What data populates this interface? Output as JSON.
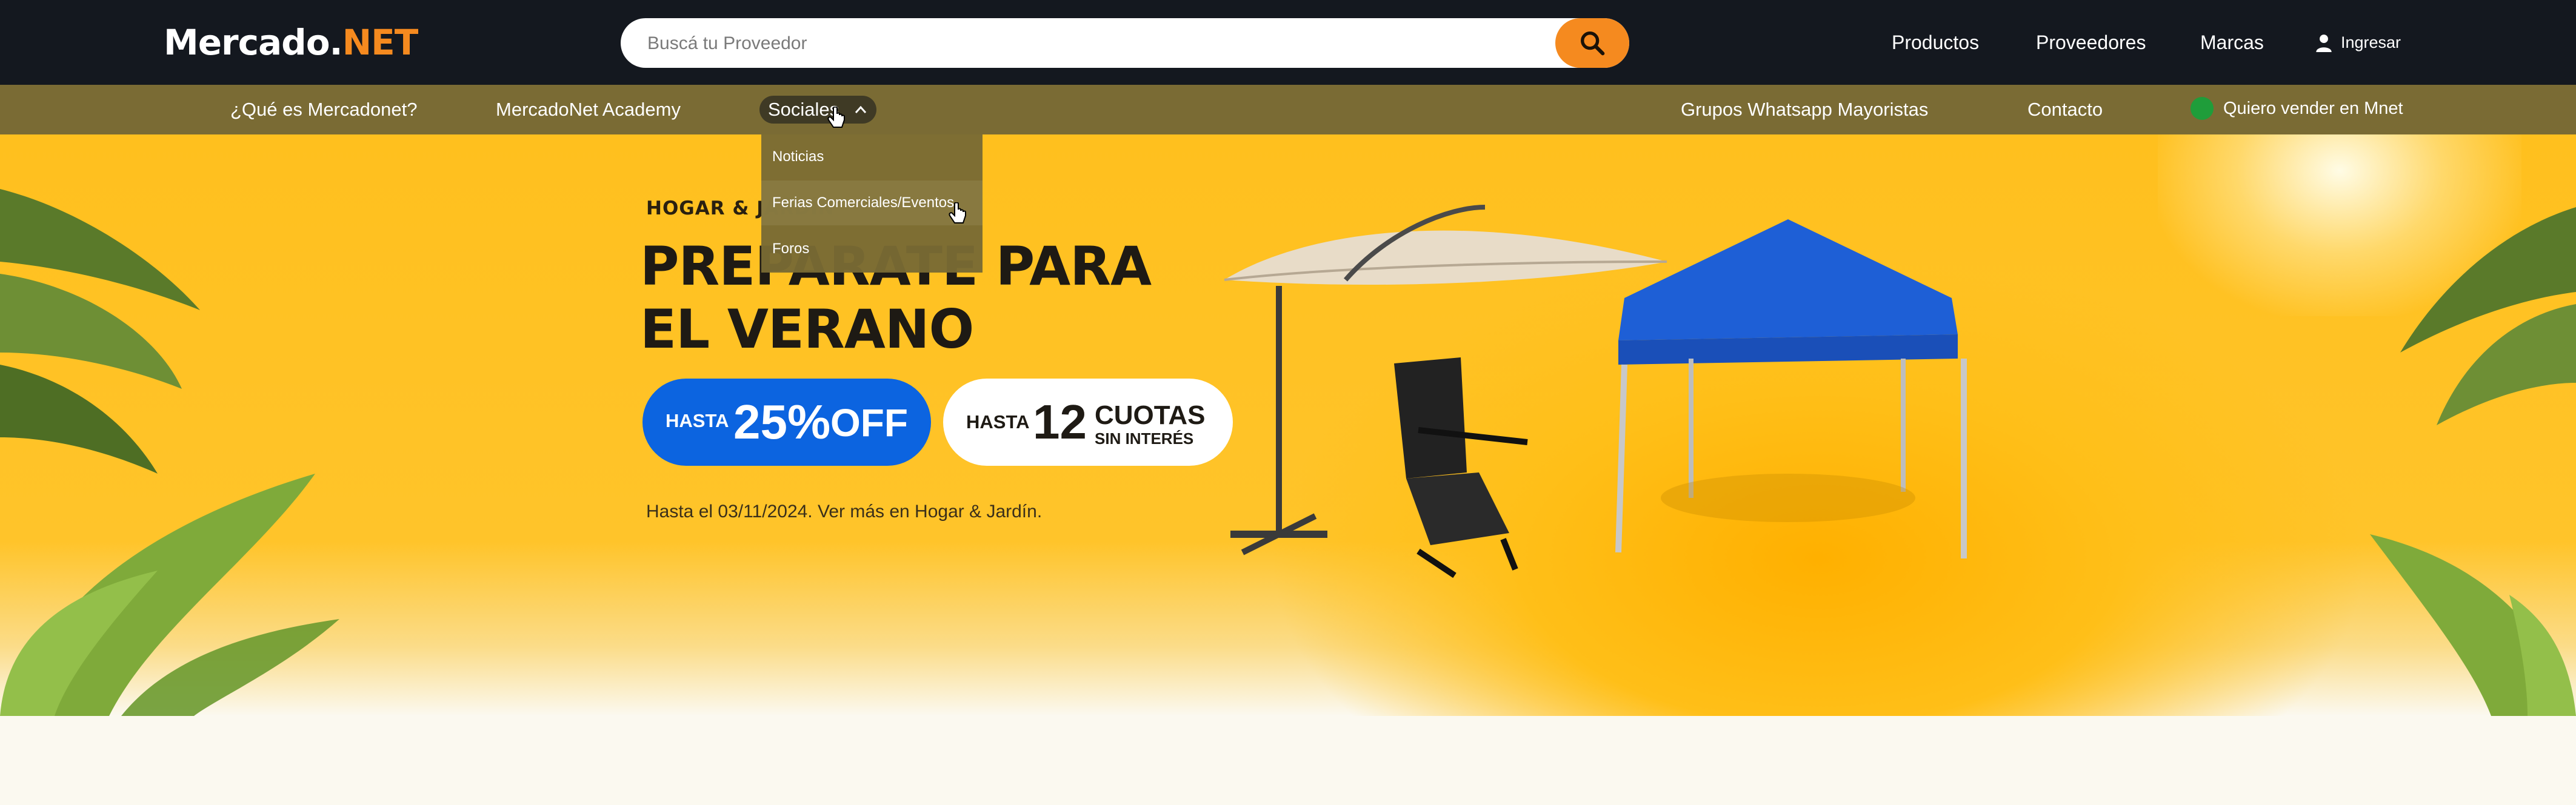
{
  "header": {
    "logo_main": "Mercado.",
    "logo_accent": "NET",
    "search": {
      "placeholder": "Buscá tu Proveedor"
    },
    "links": {
      "productos": "Productos",
      "proveedores": "Proveedores",
      "marcas": "Marcas"
    },
    "login": "Ingresar"
  },
  "nav": {
    "que_es": "¿Qué es Mercadonet?",
    "academy": "MercadoNet Academy",
    "sociales": "Sociales",
    "grupos": "Grupos Whatsapp Mayoristas",
    "contacto": "Contacto",
    "vender": "Quiero vender en Mnet"
  },
  "dropdown": {
    "items": [
      "Noticias",
      "Ferias Comerciales/Eventos",
      "Foros"
    ]
  },
  "hero": {
    "category": "HOGAR & JARDÍN",
    "title_line1": "PREPARATE PARA",
    "title_line2": "EL VERANO",
    "discount_prefix": "HASTA",
    "discount_value": "25%",
    "discount_suffix": "OFF",
    "cuotas_prefix": "HASTA",
    "cuotas_value": "12",
    "cuotas_line1": "CUOTAS",
    "cuotas_line2": "SIN INTERÉS",
    "note": "Hasta el 03/11/2024. Ver más en Hogar & Jardín."
  },
  "colors": {
    "topbar_bg": "#14181f",
    "navbar_bg": "#7a6b34",
    "accent_orange": "#f58a1f",
    "hero_yellow": "#ffc01e",
    "discount_blue": "#0c64e0"
  },
  "icons": [
    "search-icon",
    "user-icon",
    "chevron-up-icon",
    "whatsapp-icon",
    "pointer-cursor-icon"
  ]
}
